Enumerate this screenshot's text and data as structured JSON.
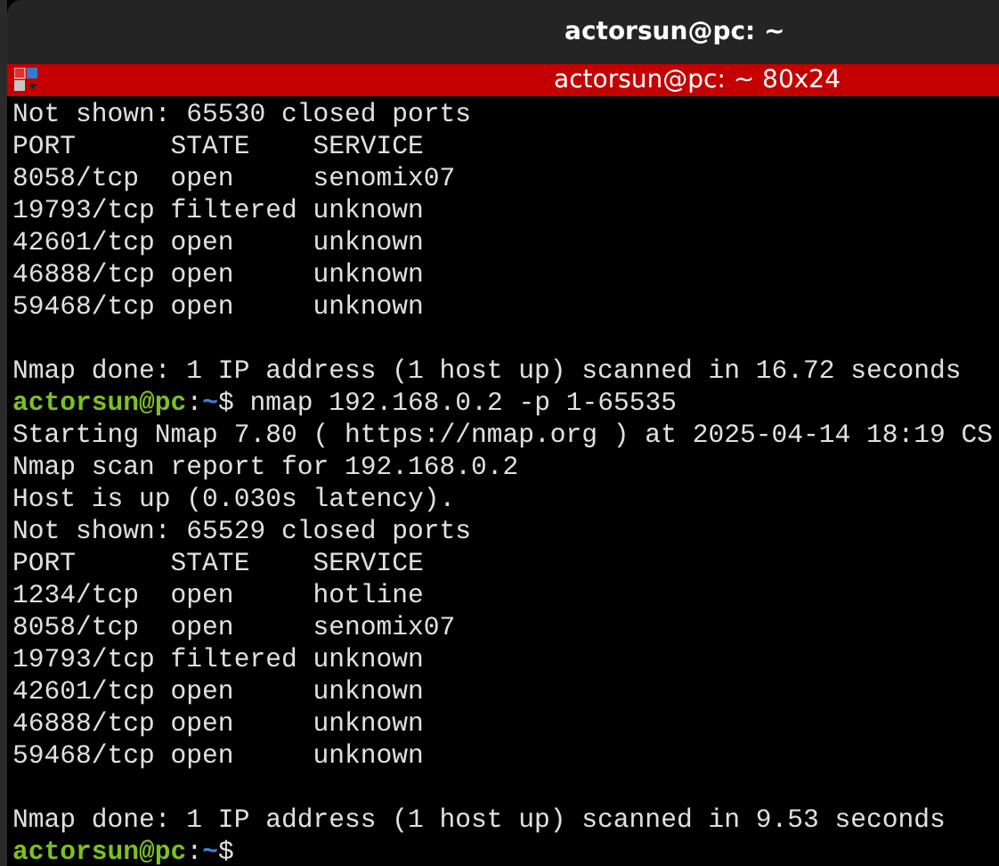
{
  "window": {
    "title": "actorsun@pc: ~"
  },
  "tab_bar": {
    "title": "actorsun@pc: ~ 80x24"
  },
  "terminal": {
    "lines": [
      {
        "kind": "output",
        "text": "Not shown: 65530 closed ports"
      },
      {
        "kind": "output",
        "text": "PORT      STATE    SERVICE"
      },
      {
        "kind": "output",
        "text": "8058/tcp  open     senomix07"
      },
      {
        "kind": "output",
        "text": "19793/tcp filtered unknown"
      },
      {
        "kind": "output",
        "text": "42601/tcp open     unknown"
      },
      {
        "kind": "output",
        "text": "46888/tcp open     unknown"
      },
      {
        "kind": "output",
        "text": "59468/tcp open     unknown"
      },
      {
        "kind": "blank"
      },
      {
        "kind": "output",
        "text": "Nmap done: 1 IP address (1 host up) scanned in 16.72 seconds"
      },
      {
        "kind": "prompt",
        "user": "actorsun@pc",
        "sep": ":",
        "path": "~",
        "symbol": "$",
        "command": "nmap 192.168.0.2 -p 1-65535"
      },
      {
        "kind": "output",
        "text": "Starting Nmap 7.80 ( https://nmap.org ) at 2025-04-14 18:19 CS"
      },
      {
        "kind": "output",
        "text": "Nmap scan report for 192.168.0.2"
      },
      {
        "kind": "output",
        "text": "Host is up (0.030s latency)."
      },
      {
        "kind": "output",
        "text": "Not shown: 65529 closed ports"
      },
      {
        "kind": "output",
        "text": "PORT      STATE    SERVICE"
      },
      {
        "kind": "output",
        "text": "1234/tcp  open     hotline"
      },
      {
        "kind": "output",
        "text": "8058/tcp  open     senomix07"
      },
      {
        "kind": "output",
        "text": "19793/tcp filtered unknown"
      },
      {
        "kind": "output",
        "text": "42601/tcp open     unknown"
      },
      {
        "kind": "output",
        "text": "46888/tcp open     unknown"
      },
      {
        "kind": "output",
        "text": "59468/tcp open     unknown"
      },
      {
        "kind": "blank"
      },
      {
        "kind": "output",
        "text": "Nmap done: 1 IP address (1 host up) scanned in 9.53 seconds"
      },
      {
        "kind": "prompt",
        "user": "actorsun@pc",
        "sep": ":",
        "path": "~",
        "symbol": "$"
      }
    ]
  }
}
